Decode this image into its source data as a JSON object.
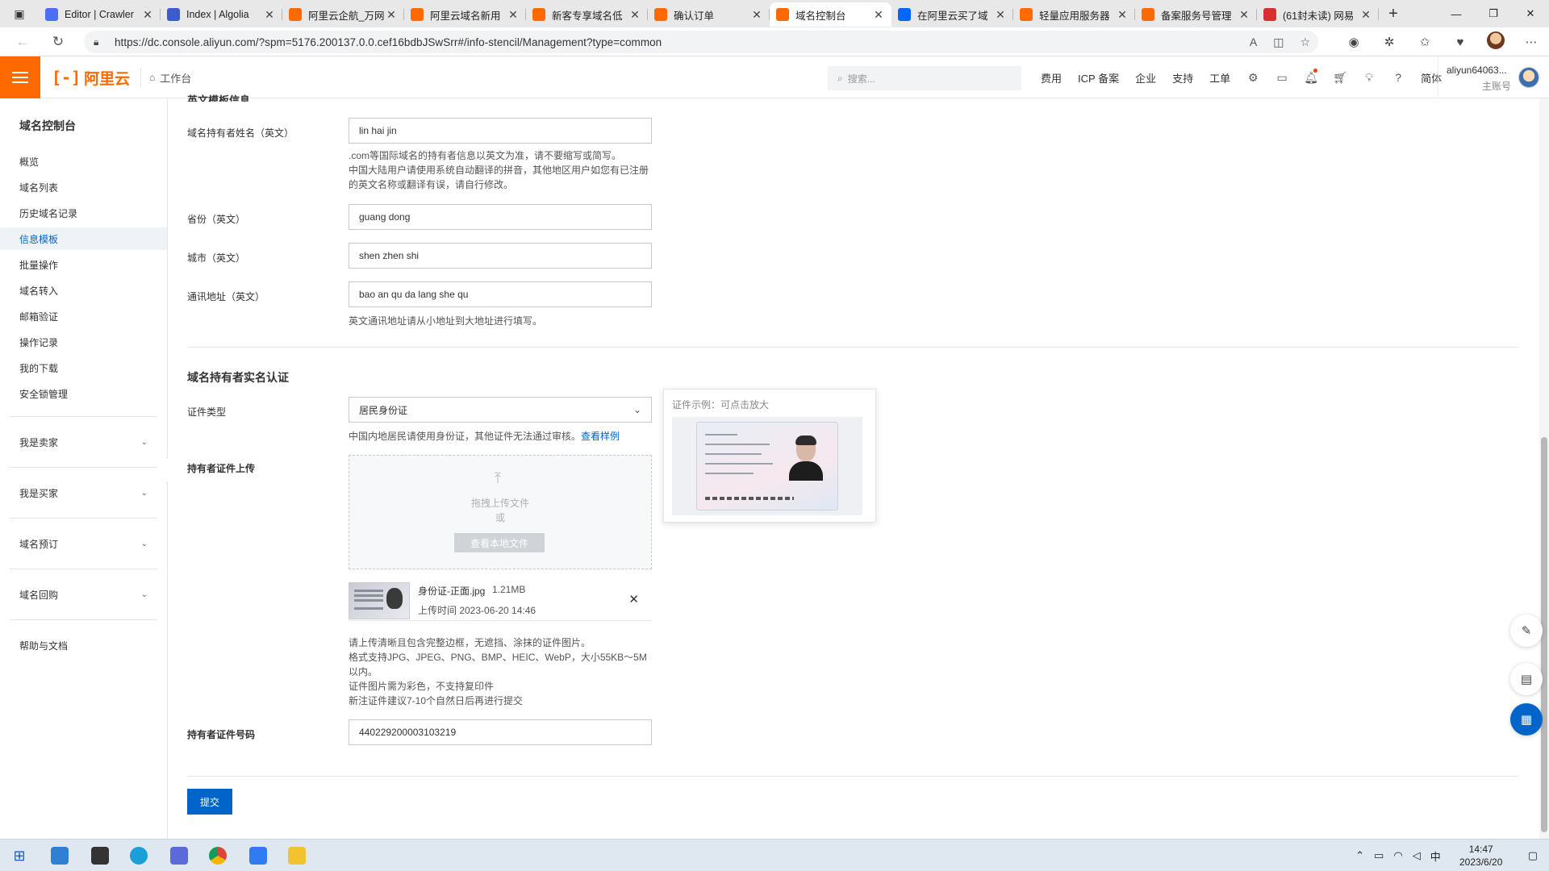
{
  "browser": {
    "tabs": [
      {
        "title": "Editor | Crawler",
        "favicon": "editor-favicon",
        "color": "#4a6ef5"
      },
      {
        "title": "Index | Algolia",
        "favicon": "algolia-favicon",
        "color": "#3b5ccc"
      },
      {
        "title": "阿里云企航_万网",
        "favicon": "aliyun-favicon",
        "color": "#ff6a00"
      },
      {
        "title": "阿里云域名新用",
        "favicon": "aliyun-favicon",
        "color": "#ff6a00"
      },
      {
        "title": "新客专享域名低",
        "favicon": "aliyun-favicon",
        "color": "#ff6a00"
      },
      {
        "title": "确认订单",
        "favicon": "aliyun-favicon",
        "color": "#ff6a00"
      },
      {
        "title": "域名控制台",
        "favicon": "aliyun-favicon",
        "color": "#ff6a00",
        "active": true
      },
      {
        "title": "在阿里云买了域",
        "favicon": "zhihu-favicon",
        "color": "#0066ff"
      },
      {
        "title": "轻量应用服务器",
        "favicon": "aliyun-favicon",
        "color": "#ff6a00"
      },
      {
        "title": "备案服务号管理",
        "favicon": "aliyun-favicon",
        "color": "#ff6a00"
      },
      {
        "title": "(61封未读) 网易",
        "favicon": "netease-favicon",
        "color": "#d92f2f"
      }
    ],
    "url": "https://dc.console.aliyun.com/?spm=5176.200137.0.0.cef16bdbJSwSrr#/info-stencil/Management?type=common"
  },
  "header": {
    "logo_text": "阿里云",
    "logo_mark": "[-]",
    "workbench": "工作台",
    "search_placeholder": "搜索...",
    "nav": [
      "费用",
      "ICP 备案",
      "企业",
      "支持",
      "工单"
    ],
    "lang": "简体",
    "account_name": "aliyun64063...",
    "account_role": "主账号",
    "brand_color": "#ff6a00"
  },
  "sidebar": {
    "title": "域名控制台",
    "items": [
      "概览",
      "域名列表",
      "历史域名记录",
      "信息模板",
      "批量操作",
      "域名转入",
      "邮箱验证",
      "操作记录",
      "我的下载",
      "安全锁管理"
    ],
    "active_index": 3,
    "groups": [
      "我是卖家",
      "我是买家",
      "域名预订",
      "域名回购"
    ],
    "help": "帮助与文档"
  },
  "form": {
    "clipped_section_title": "英文模板信息",
    "owner_name_label": "域名持有者姓名（英文）",
    "owner_name_value": "lin hai jin",
    "owner_name_help1": ".com等国际域名的持有者信息以英文为准，请不要缩写或简写。",
    "owner_name_help2": "中国大陆用户请使用系统自动翻译的拼音，其他地区用户如您有已注册",
    "owner_name_help3": "的英文名称或翻译有误，请自行修改。",
    "province_label": "省份（英文）",
    "province_value": "guang dong",
    "city_label": "城市（英文）",
    "city_value": "shen zhen shi",
    "address_label": "通讯地址（英文）",
    "address_value": "bao an qu da lang she qu",
    "address_help": "英文通讯地址请从小地址到大地址进行填写。",
    "realname_section": "域名持有者实名认证",
    "cert_type_label": "证件类型",
    "cert_type_value": "居民身份证",
    "cert_type_help": "中国内地居民请使用身份证，其他证件无法通过审核。",
    "cert_type_link": "查看样例",
    "upload_label": "持有者证件上传",
    "upload_drag": "拖拽上传文件",
    "upload_or": "或",
    "upload_button": "查看本地文件",
    "file_name": "身份证-正面.jpg",
    "file_size": "1.21MB",
    "file_time": "上传时间 2023-06-20 14:46",
    "upload_help1": "请上传清晰且包含完整边框，无遮挡、涂抹的证件图片。",
    "upload_help2": "格式支持JPG、JPEG、PNG、BMP、HEIC、WebP，大小55KB～5M",
    "upload_help3": "以内。",
    "upload_help4": "证件图片需为彩色，不支持复印件",
    "upload_help5": "新注证件建议7-10个自然日后再进行提交",
    "cert_no_label": "持有者证件号码",
    "cert_no_value": "440229200003103219",
    "submit": "提交"
  },
  "popover": {
    "title": "证件示例：可点击放大"
  },
  "taskbar": {
    "time": "14:47",
    "date": "2023/6/20",
    "ime": "中"
  }
}
